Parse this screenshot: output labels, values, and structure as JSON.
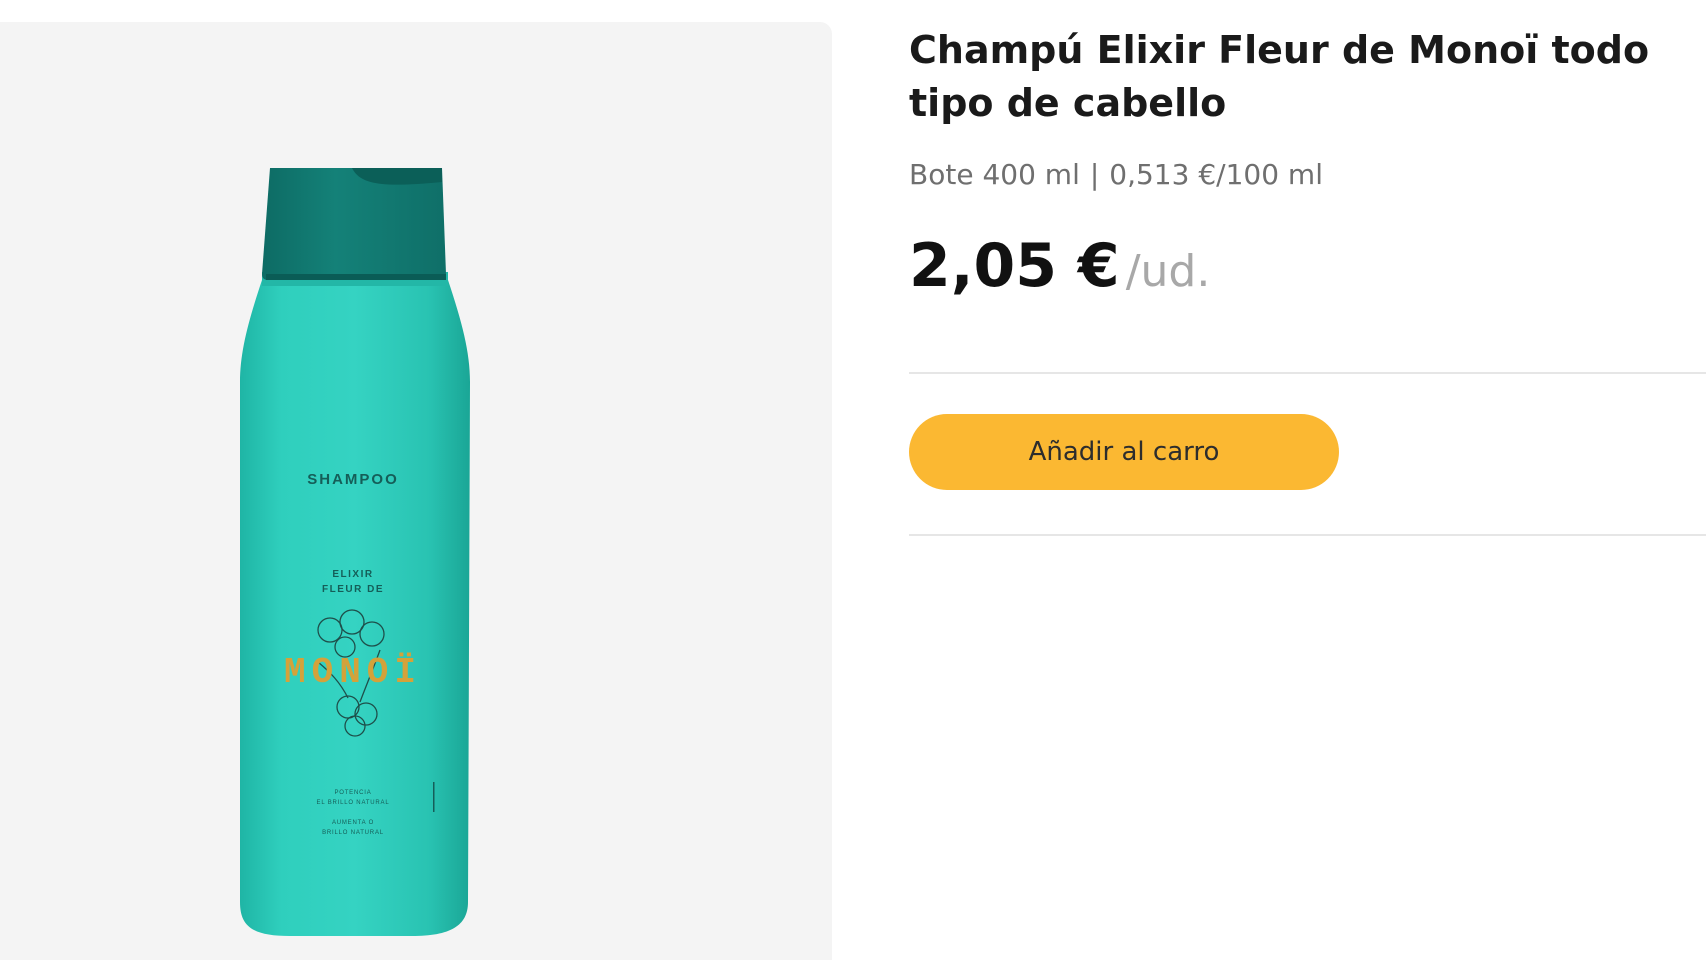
{
  "product": {
    "title": "Champú Elixir Fleur de Monoï todo tipo de cabello",
    "packaging": "Bote 400 ml",
    "separator": "|",
    "unit_price": "0,513 €/100 ml",
    "price": "2,05 €",
    "price_unit": "/ud.",
    "add_to_cart_label": "Añadir al carro"
  },
  "bottle_label": {
    "top": "SHAMPOO",
    "line1": "ELIXIR",
    "line2": "FLEUR DE",
    "brand": "MONOÏ",
    "small1": "POTENCIA",
    "small2": "EL BRILLO NATURAL",
    "small3": "AUMENTA O",
    "small4": "BRILLO NATURAL"
  },
  "colors": {
    "accent": "#fbb832",
    "bottle": "#2ec9b8",
    "cap": "#117a72",
    "label_gold": "#d4a23a"
  }
}
